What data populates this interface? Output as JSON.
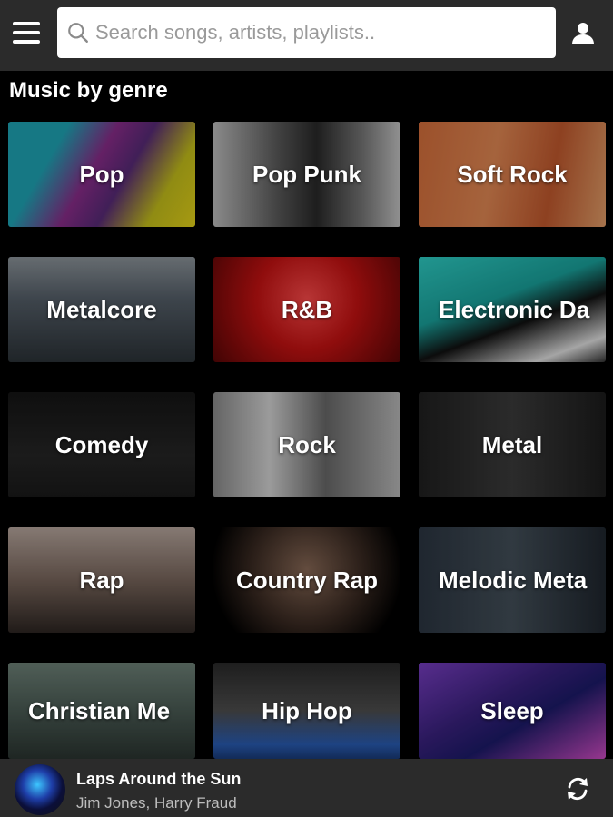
{
  "header": {
    "menu_icon": "hamburger-menu-icon",
    "search": {
      "placeholder": "Search songs, artists, playlists..",
      "value": ""
    },
    "profile_icon": "user-profile-icon"
  },
  "section": {
    "title": "Music by genre"
  },
  "genres": [
    {
      "label": "Pop"
    },
    {
      "label": "Pop Punk"
    },
    {
      "label": "Soft Rock"
    },
    {
      "label": "Metalcore"
    },
    {
      "label": "R&B"
    },
    {
      "label": "Electronic Da"
    },
    {
      "label": "Comedy"
    },
    {
      "label": "Rock"
    },
    {
      "label": "Metal"
    },
    {
      "label": "Rap"
    },
    {
      "label": "Country Rap"
    },
    {
      "label": "Melodic Meta"
    },
    {
      "label": "Christian Me"
    },
    {
      "label": "Hip Hop"
    },
    {
      "label": "Sleep"
    }
  ],
  "player": {
    "track_title": "Laps Around the Sun",
    "track_artist": "Jim Jones, Harry Fraud",
    "action_icon": "refresh-icon"
  },
  "colors": {
    "topbar_bg": "#2b2b2b",
    "page_bg": "#000000",
    "player_bg": "#2b2b2b"
  }
}
